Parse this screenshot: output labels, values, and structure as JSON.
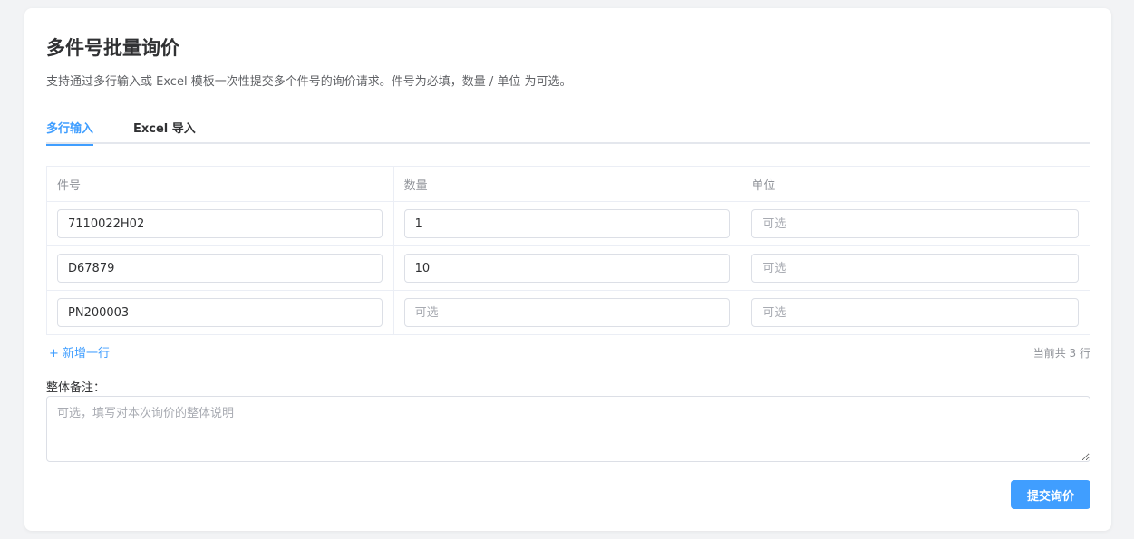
{
  "header": {
    "title": "多件号批量询价",
    "subtitle": "支持通过多行输入或 Excel 模板一次性提交多个件号的询价请求。件号为必填，数量 / 单位 为可选。"
  },
  "tabs": [
    {
      "label": "多行输入",
      "active": true
    },
    {
      "label": "Excel 导入",
      "active": false
    }
  ],
  "table": {
    "columns": [
      "件号",
      "数量",
      "单位"
    ],
    "rows": [
      {
        "part": "7110022H02",
        "qty": "1",
        "unit": ""
      },
      {
        "part": "D67879",
        "qty": "10",
        "unit": ""
      },
      {
        "part": "PN200003",
        "qty": "",
        "unit": ""
      }
    ],
    "optional_placeholder": "可选"
  },
  "add_row_label": "+ 新增一行",
  "row_count_label": "当前共 3 行",
  "remark": {
    "label": "整体备注：",
    "placeholder": "可选，填写对本次询价的整体说明"
  },
  "submit_label": "提交询价",
  "colors": {
    "accent": "#409eff",
    "background": "#f2f3f5"
  }
}
